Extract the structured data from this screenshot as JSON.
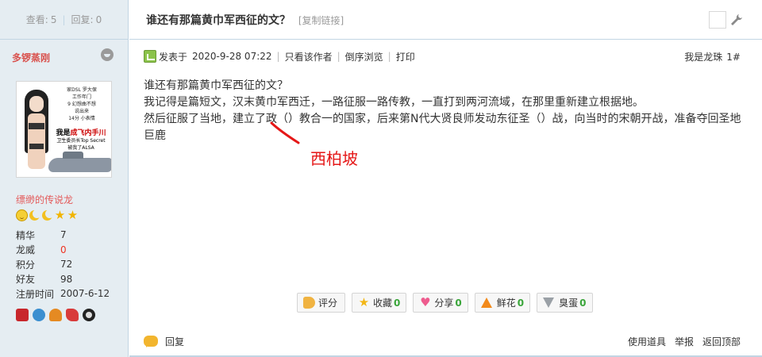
{
  "stats": {
    "views_label": "查看:",
    "views": "5",
    "replies_label": "回复:",
    "replies": "0"
  },
  "author": {
    "name": "多锣蒸刚",
    "avatar": {
      "lines": [
        "家DSL  罗大保",
        "工作年门",
        "9 幻想曲不想",
        "说出来",
        "14分 小表情",
        "我是",
        "成飞内手川",
        "卫生委员长Top Secret",
        "被我了ALSA"
      ],
      "headline_prefix": "我是",
      "headline_red": "成飞内手川"
    },
    "group": "缥缈的传说龙",
    "profile": [
      {
        "key": "精华",
        "value": "7",
        "red": false
      },
      {
        "key": "龙威",
        "value": "0",
        "red": true
      },
      {
        "key": "积分",
        "value": "72",
        "red": false
      },
      {
        "key": "好友",
        "value": "98",
        "red": false
      },
      {
        "key": "注册时间",
        "value": "2007-6-12",
        "red": false
      }
    ]
  },
  "thread": {
    "title": "谁还有那篇黄巾军西征的文？",
    "copy_link": "[复制链接]"
  },
  "post": {
    "posted_prefix": "发表于",
    "posted_time": "2020-9-28 07:22",
    "author_only": "只看该作者",
    "reverse": "倒序浏览",
    "print": "打印",
    "floor_name": "我是龙珠",
    "floor_num": "1#",
    "lines": [
      "谁还有那篇黄巾军西征的文？",
      "我记得是篇短文，汉末黄巾军西迁，一路征服一路传教，一直打到两河流域，在那里重新建立根据地。",
      "然后征服了当地，建立了政（）教合一的国家，后来第N代大贤良师发动东征圣（）战，向当时的宋朝开战，准备夺回圣地",
      "巨鹿"
    ],
    "annotation": "西柏坡"
  },
  "actions": [
    {
      "label": "评分",
      "count": "",
      "icon": "rate-icon"
    },
    {
      "label": "收藏",
      "count": "0",
      "icon": "star-icon"
    },
    {
      "label": "分享",
      "count": "0",
      "icon": "heart-icon"
    },
    {
      "label": "鲜花",
      "count": "0",
      "icon": "arrow-up-icon"
    },
    {
      "label": "臭蛋",
      "count": "0",
      "icon": "arrow-down-icon"
    }
  ],
  "footer": {
    "reply": "回复",
    "use_item": "使用道具",
    "report": "举报",
    "back_top": "返回顶部"
  },
  "colors": {
    "sidebar_bg": "#e5edf2",
    "border": "#c2d5e3",
    "red": "#e51717",
    "count_green": "#3aa53a"
  }
}
